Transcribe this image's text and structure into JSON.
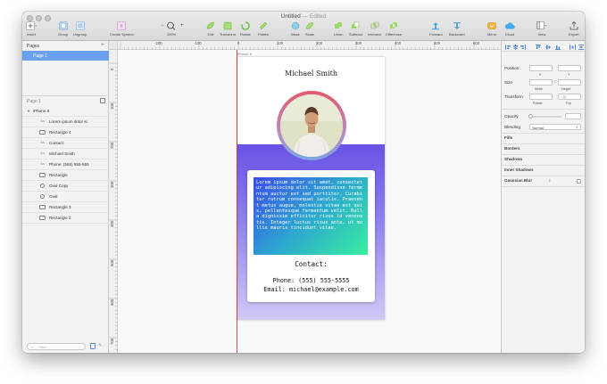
{
  "window": {
    "title": "Untitled",
    "edited": "— Edited"
  },
  "toolbar": {
    "insert": "Insert",
    "group": "Group",
    "ungroup": "Ungroup",
    "create_symbol": "Create Symbol",
    "zoom_minus": "−",
    "zoom_plus": "+",
    "zoom_level": "100%",
    "edit": "Edit",
    "transform": "Transform",
    "rotate": "Rotate",
    "flatten": "Flatten",
    "mask": "Mask",
    "scale": "Scale",
    "union": "Union",
    "subtract": "Subtract",
    "intersect": "Intersect",
    "difference": "Difference",
    "forward": "Forward",
    "backward": "Backward",
    "mirror": "Mirror",
    "cloud": "Cloud",
    "view": "View",
    "export": "Export"
  },
  "pages": {
    "header": "Pages",
    "items": [
      "Page 1"
    ],
    "current": "Page 1"
  },
  "layers": {
    "artboard": "iPhone 8",
    "items": [
      {
        "icon": "text",
        "label": "Lorem ipsum dolor si"
      },
      {
        "icon": "rect",
        "label": "Rectangle 4"
      },
      {
        "icon": "text",
        "label": "Contact:"
      },
      {
        "icon": "text",
        "label": "Michael Smith"
      },
      {
        "icon": "text",
        "label": "Phone: (555) 555-555"
      },
      {
        "icon": "rect",
        "label": "Rectangle"
      },
      {
        "icon": "oval",
        "label": "Oval Copy"
      },
      {
        "icon": "oval",
        "label": "Oval"
      },
      {
        "icon": "rect",
        "label": "Rectangle 3"
      },
      {
        "icon": "rect",
        "label": "Rectangle 2"
      }
    ],
    "filter_placeholder": "Filter"
  },
  "rulers": {
    "horizontal": [
      "-200",
      "-100",
      "0",
      "100",
      "200",
      "300",
      "400",
      "500",
      "600"
    ],
    "vertical": [
      "0",
      "100",
      "200",
      "300",
      "400",
      "500",
      "600",
      "700"
    ]
  },
  "artboard": {
    "label": "iPhone 8",
    "name": "Michael Smith",
    "lorem": "Lorem ipsum dolor sit amet, consectetur adipiscing elit. Suspendisse fermentum auctor est sed porttitor. Curabitur rutrum consequat iaculis. Praesent metus augue, molestie vitae est quis, pellentesque fermentum velit. Nulla dignissim efficitur risus id venenatis. Integer luctus risus ante, ut mollis mauris tincidunt vitae.",
    "contact_heading": "Contact:",
    "phone": "Phone: (555) 555-5555",
    "email": "Email: michael@example.com"
  },
  "inspector": {
    "position": "Position",
    "x": "X",
    "y": "Y",
    "size": "Size",
    "width": "Width",
    "height": "Height",
    "transform": "Transform",
    "rotate": "Rotate",
    "flip": "Flip",
    "opacity": "Opacity",
    "blending": "Blending",
    "blending_value": "Normal",
    "fills": "Fills",
    "borders": "Borders",
    "shadows": "Shadows",
    "inner_shadows": "Inner Shadows",
    "gaussian_blur": "Gaussian Blur"
  },
  "colors": {
    "selection": "#6aa0f0",
    "guide": "#e04545",
    "gradient_top": "#6852e6",
    "gradient_bottom": "#d2c9f5",
    "lorem_start": "#3b4ce8",
    "lorem_end": "#38f0a0"
  }
}
